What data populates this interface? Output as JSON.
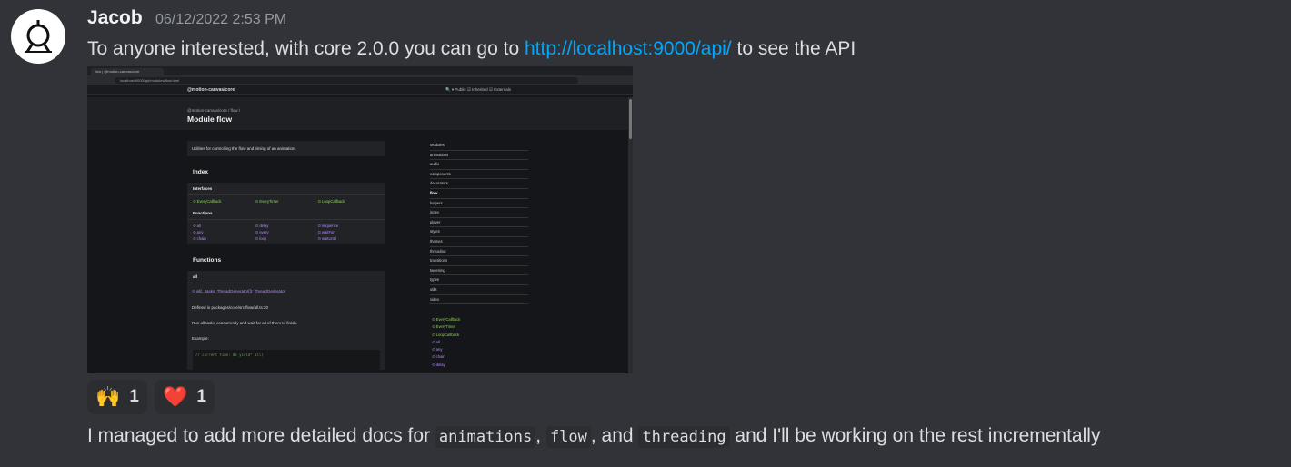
{
  "message": {
    "author": "Jacob",
    "timestamp": "06/12/2022 2:53 PM",
    "text_before_link": "To anyone interested, with core 2.0.0 you can go to ",
    "link": "http://localhost:9000/api/",
    "text_after_link": " to see the API",
    "line2": {
      "t1": "I managed to add more detailed docs for ",
      "code1": "animations",
      "t2": ", ",
      "code2": "flow",
      "t3": ", and ",
      "code3": "threading",
      "t4": " and I'll be working on the rest incrementally"
    }
  },
  "reactions": [
    {
      "emoji": "🙌",
      "count": "1"
    },
    {
      "emoji": "❤️",
      "count": "1"
    }
  ],
  "screenshot": {
    "tab_title": "flow | @motion-canvas/core",
    "url": "localhost:9000/api/modules/flow.html",
    "brand": "@motion-canvas/core",
    "nav": "🔍  ▾ Public  ☑ Inherited  ☑ Externals",
    "breadcrumb": "@motion-canvas/core / flow /",
    "title": "Module flow",
    "description": "Utilities for controlling the flow and timing of an animation.",
    "index_title": "Index",
    "interfaces_label": "Interfaces",
    "interfaces": [
      "⊙ EveryCallback",
      "⊙ EveryTimer",
      "⊙ LoopCallback"
    ],
    "functions_label": "Functions",
    "functions": [
      "⊙ all",
      "⊙ delay",
      "⊙ sequence",
      "⊙ any",
      "⊙ every",
      "⊙ waitFor",
      "⊙ chain",
      "⊙ loop",
      "⊙ waitUntil"
    ],
    "functions_title": "Functions",
    "fn_all": "all",
    "fn_sig": "⊙ all(...tasks: ThreadGenerator[]): ThreadGenerator",
    "defined_in": "Defined in packages/core/src/flow/all.ts:20",
    "run_all": "Run all tasks concurrently and wait for all of them to finish.",
    "example": "Example:",
    "code_line": "// current time: 0s  yield* all(",
    "sidebar": [
      "Modules",
      "animations",
      "audio",
      "components",
      "decorators",
      "flow",
      "helpers",
      "index",
      "player",
      "styles",
      "themes",
      "threading",
      "transitions",
      "tweening",
      "types",
      "utils",
      "video"
    ],
    "sidebar_active": "flow",
    "sidebar2": [
      "⊙ EveryCallback",
      "⊙ EveryTimer",
      "⊙ LoopCallback",
      "⊙ all",
      "⊙ any",
      "⊙ chain",
      "⊙ delay"
    ]
  }
}
